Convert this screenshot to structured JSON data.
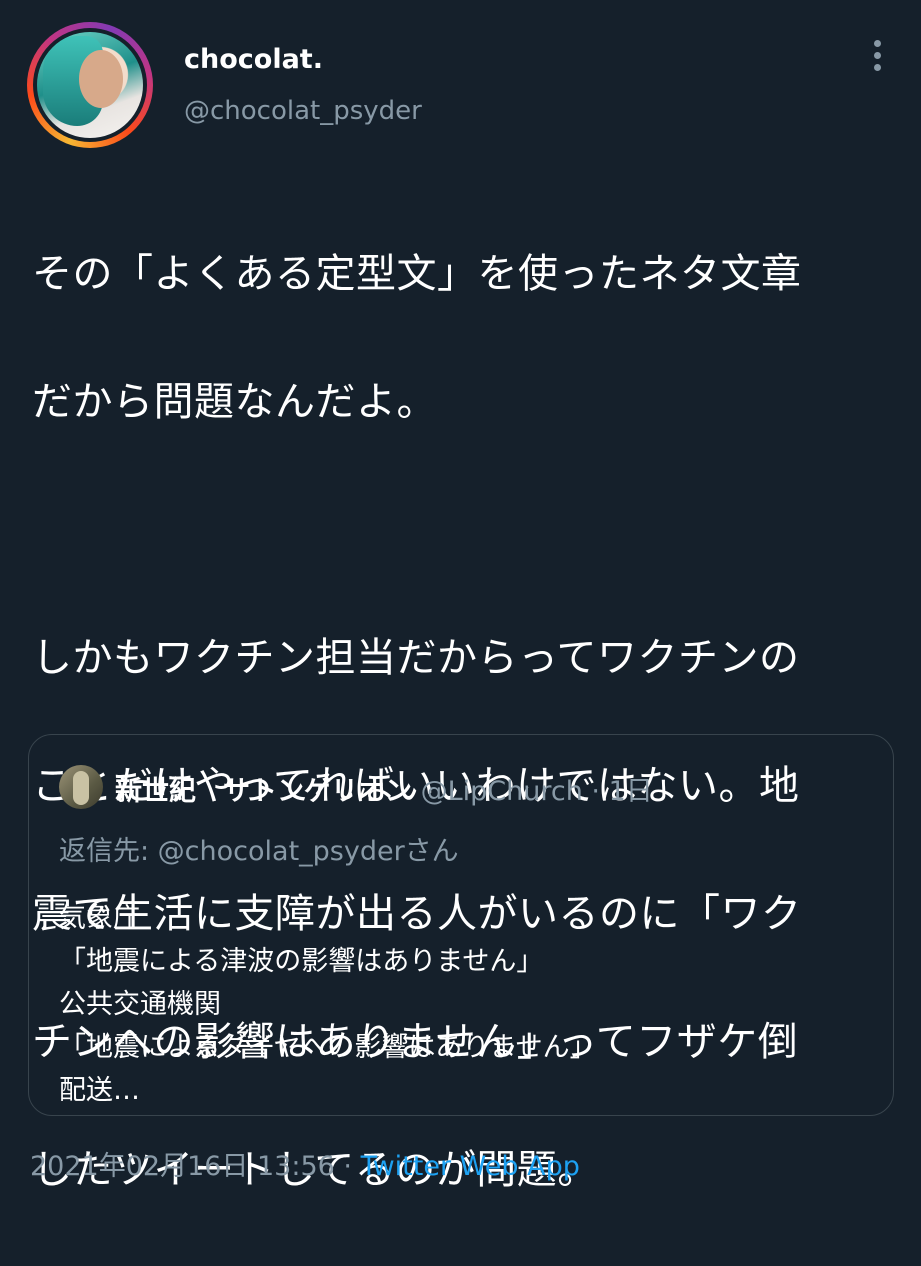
{
  "author": {
    "display_name": "chocolat.",
    "handle": "@chocolat_psyder"
  },
  "tweet": {
    "lines": [
      "その「よくある定型文」を使ったネタ文章",
      "だから問題なんだよ。",
      "",
      "しかもワクチン担当だからってワクチンの",
      "ことだけやってればいいわけではない。地",
      "震で生活に支障が出る人がいるのに「ワク",
      "チンへの影響はありません」ってフザケ倒",
      "したツイートしてるのが問題。"
    ]
  },
  "quoted_tweet": {
    "display_name": "新世紀　サトンゲリオン",
    "handle": "@LipChurch",
    "separator": " · ",
    "time": "1日",
    "reply_to": "返信先: @chocolat_psyderさん",
    "body_lines": [
      "気象庁",
      "「地震による津波の影響はありません」",
      "公共交通機関",
      "「地震によるダイヤへの影響はありません」",
      "配送…"
    ]
  },
  "meta": {
    "timestamp": "2021年02月16日 13:56",
    "separator": " · ",
    "source": "Twitter Web App"
  },
  "colors": {
    "background": "#15202b",
    "text": "#ffffff",
    "secondary": "#8899a6",
    "link": "#1da1f2",
    "border": "#38444d"
  },
  "icons": {
    "more": "more-vertical-icon"
  }
}
